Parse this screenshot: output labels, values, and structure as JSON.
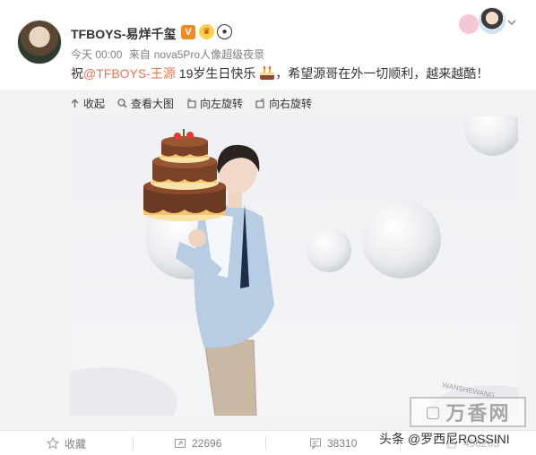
{
  "post": {
    "username": "TFBOYS-易烊千玺",
    "vip_badge": "V",
    "time": "今天 00:00",
    "source_prefix": "来自",
    "source": "nova5Pro人像超级夜景",
    "text_prefix": "祝",
    "mention": "@TFBOYS-王源",
    "text_after_mention": " 19岁生日快乐",
    "text_suffix": "，希望源哥在外一切顺利，越来越酷！"
  },
  "toolbar": {
    "collapse": "收起",
    "view_large": "查看大图",
    "rotate_left": "向左旋转",
    "rotate_right": "向右旋转"
  },
  "footer": {
    "favorite": "收藏",
    "repost_count": "22696",
    "comment_count": "38310",
    "like_count": "456203"
  },
  "watermark": {
    "caption": "头条 @罗西尼ROSSINI",
    "site": "万香网",
    "arc_text": "WANSHEWANG"
  },
  "colors": {
    "mention": "#eb7350",
    "vip": "#f08a24",
    "muted": "#808080"
  }
}
